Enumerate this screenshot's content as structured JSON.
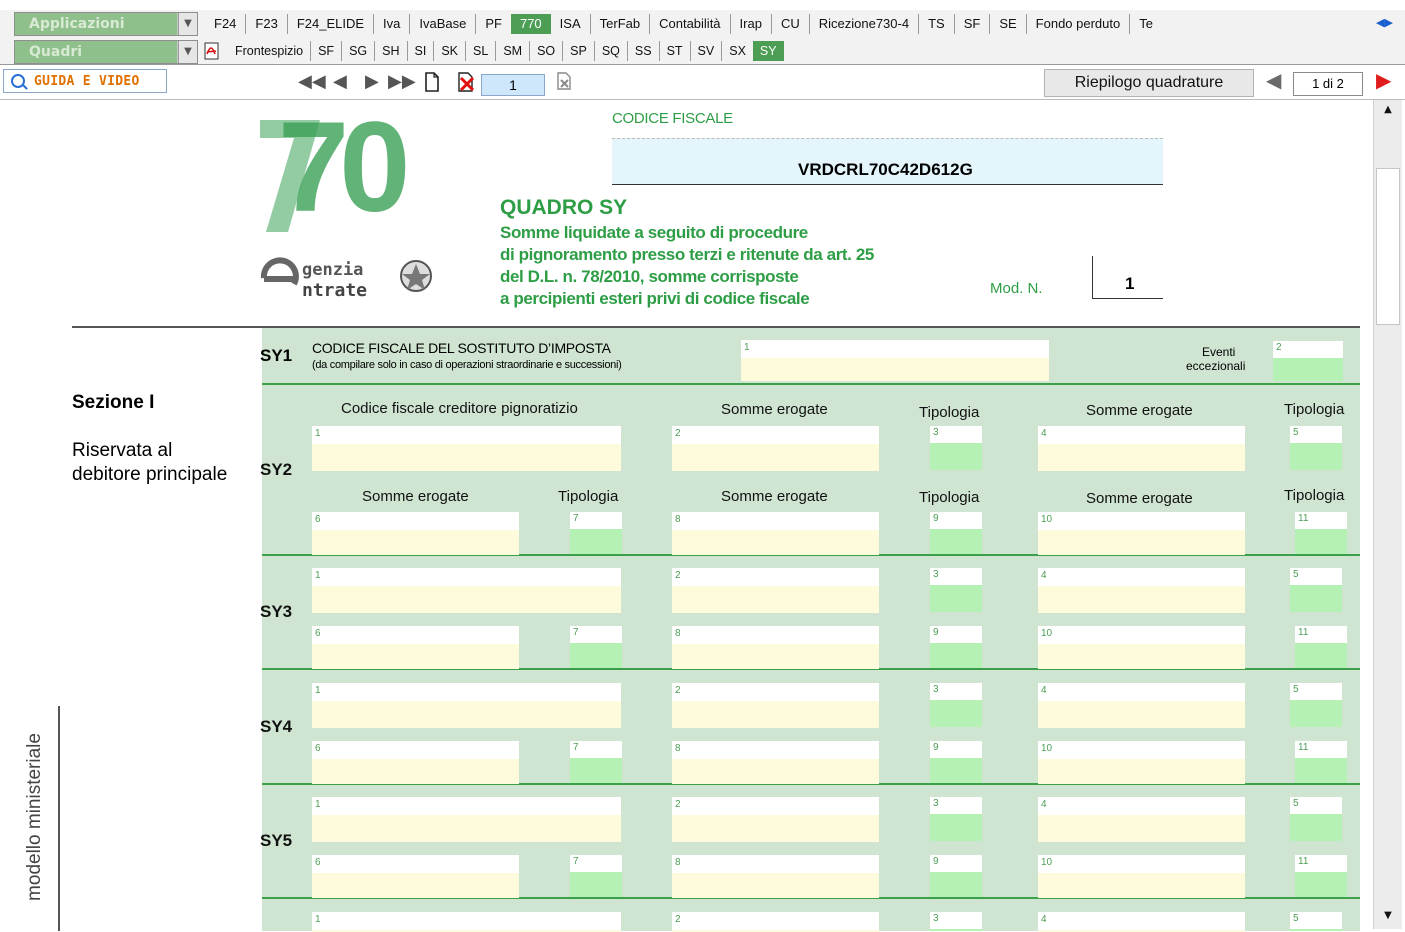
{
  "toolbar1": {
    "combo_label": "Applicazioni",
    "tabs": [
      "F24",
      "F23",
      "F24_ELIDE",
      "Iva",
      "IvaBase",
      "PF",
      "770",
      "ISA",
      "TerFab",
      "Contabilità",
      "Irap",
      "CU",
      "Ricezione730-4",
      "TS",
      "SF",
      "SE",
      "Fondo perduto",
      "Te"
    ],
    "active_tab": "770"
  },
  "toolbar2": {
    "combo_label": "Quadri",
    "tabs": [
      "Frontespizio",
      "SF",
      "SG",
      "SH",
      "SI",
      "SK",
      "SL",
      "SM",
      "SO",
      "SP",
      "SQ",
      "SS",
      "ST",
      "SV",
      "SX",
      "SY"
    ],
    "active_tab": "SY"
  },
  "navbar": {
    "guida_label": "GUIDA E VIDEO",
    "page_value": "1",
    "riepilogo_label": "Riepilogo quadrature",
    "page_count": "1 di 2"
  },
  "form": {
    "logo_number": "70",
    "agency_top": "genzia",
    "agency_bottom": "ntrate",
    "codice_fiscale_label": "CODICE FISCALE",
    "codice_fiscale_value": "VRDCRL70C42D612G",
    "quadro_title": "QUADRO SY",
    "quadro_desc": [
      "Somme liquidate a seguito di procedure",
      "di pignoramento presso terzi e ritenute da art. 25",
      "del D.L. n. 78/2010, somme corrisposte",
      "a percipienti esteri privi di codice fiscale"
    ],
    "mod_label": "Mod. N.",
    "mod_value": "1",
    "sy1": {
      "code": "SY1",
      "label": "CODICE FISCALE DEL SOSTITUTO D’IMPOSTA",
      "sublabel": "(da compilare solo in caso di operazioni straordinarie e successioni)",
      "eventi_line1": "Eventi",
      "eventi_line2": "eccezionali"
    },
    "sezione_title": "Sezione I",
    "sezione_desc_1": "Riservata al",
    "sezione_desc_2": "debitore principale",
    "side_label": "modello ministeriale",
    "headers": {
      "codice_creditore": "Codice fiscale creditore pignoratizio",
      "somme_erogate": "Somme erogate",
      "tipologia": "Tipologia"
    },
    "rows": [
      "SY2",
      "SY3",
      "SY4",
      "SY5"
    ],
    "field_numbers": [
      "1",
      "2",
      "3",
      "4",
      "5",
      "6",
      "7",
      "8",
      "9",
      "10",
      "11"
    ]
  }
}
